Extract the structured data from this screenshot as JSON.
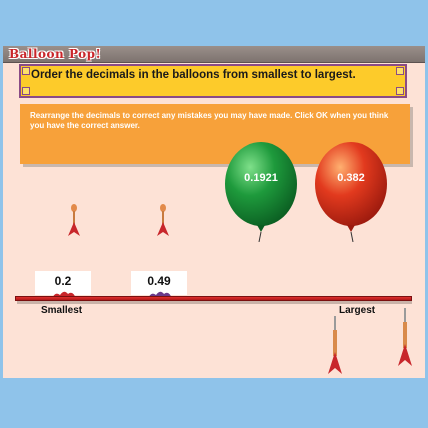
{
  "app": {
    "title": "Balloon Pop!"
  },
  "instruction": {
    "text": "Order the decimals in the balloons from smallest to largest."
  },
  "feedback": {
    "text": "Rearrange the decimals to correct any mistakes you may have made. Click OK when you think you have the correct answer."
  },
  "balloons": [
    {
      "value": "0.1921",
      "color": "#1e9a3c"
    },
    {
      "value": "0.382",
      "color": "#e23a1e"
    }
  ],
  "answers": [
    {
      "value": "0.2",
      "pop_color": "#c8262b"
    },
    {
      "value": "0.49",
      "pop_color": "#6a3a8a"
    }
  ],
  "shelf": {
    "smallest_label": "Smallest",
    "largest_label": "Largest"
  },
  "colors": {
    "background": "#fde2d6",
    "instruction": "#fdcb2a",
    "feedback": "#f7a13a",
    "shelf": "#d42523",
    "dart": "#c8262b"
  },
  "icons": {
    "dart": "dart-icon"
  }
}
